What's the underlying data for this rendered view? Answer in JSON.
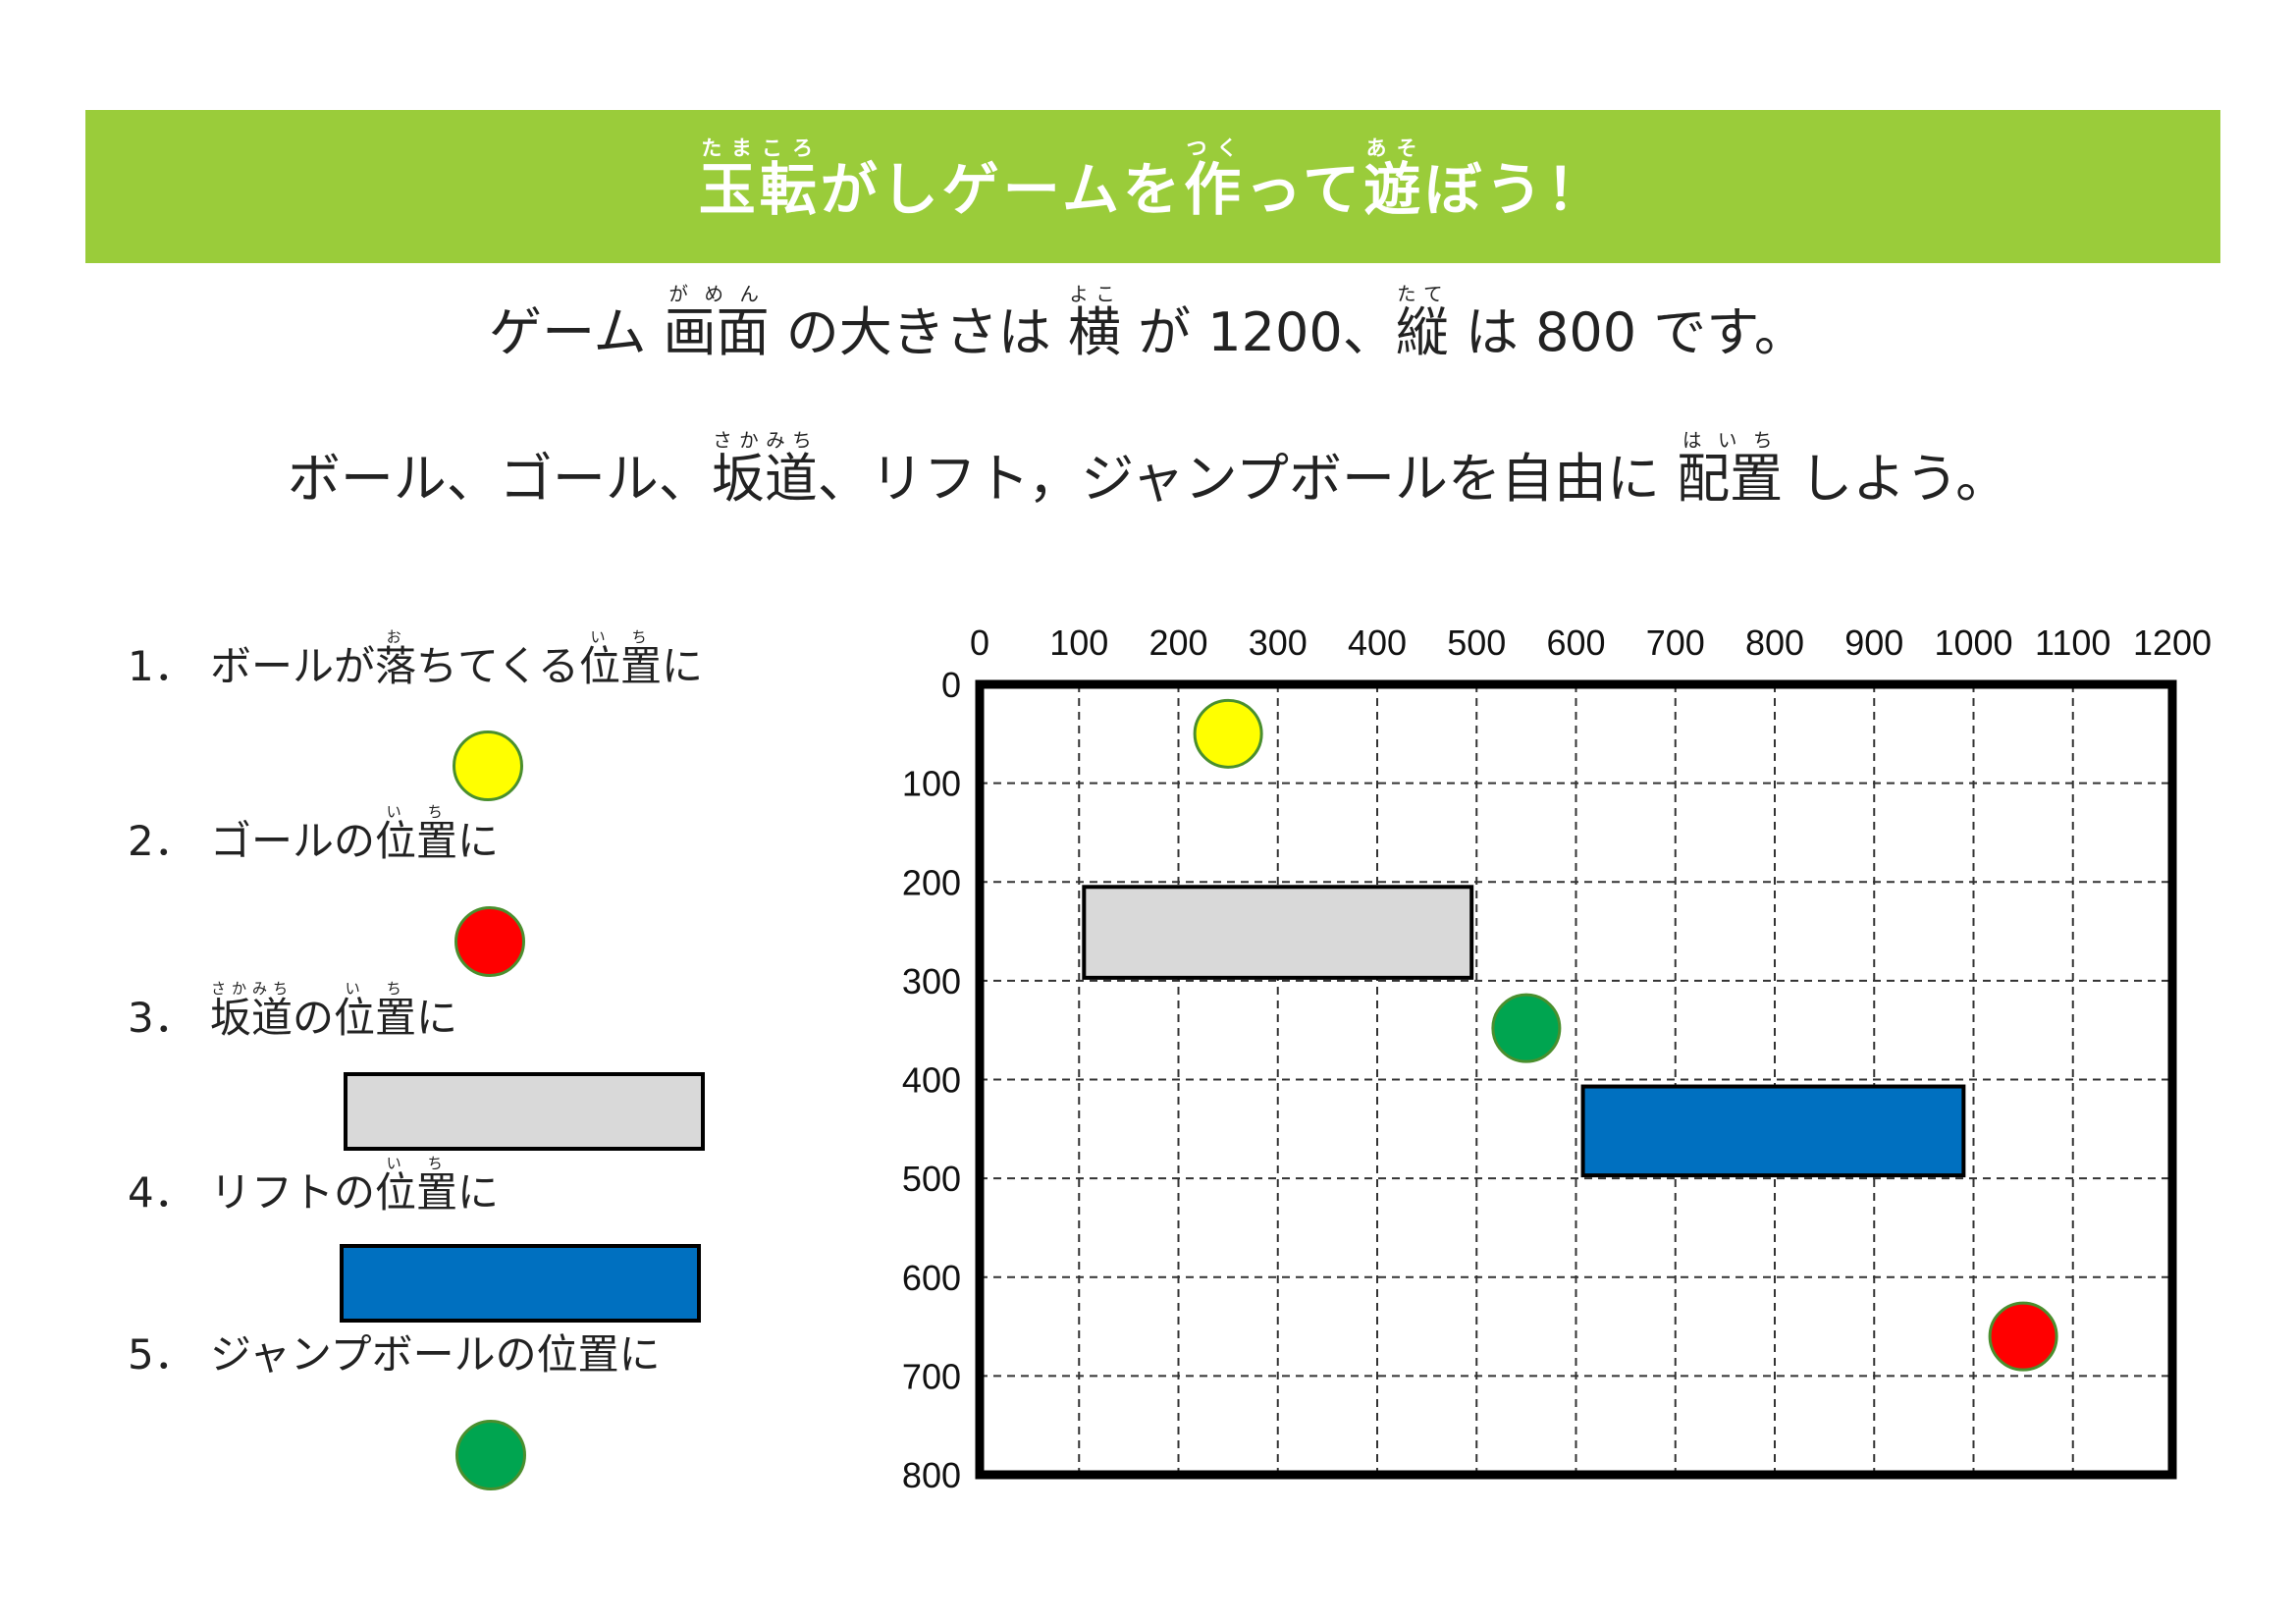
{
  "title": {
    "ruby_tamakoro": "たまころ",
    "kanji_tamakoro": "玉転",
    "part1": "がしゲームを",
    "ruby_tsuku": "つく",
    "kanji_tsuku": "作",
    "part2": "って",
    "ruby_aso": "あそ",
    "kanji_aso": "遊",
    "part3": "ぼう！"
  },
  "intro1": {
    "a": "ゲーム ",
    "ruby_gamen": "がめん",
    "kanji_gamen": "画面",
    "b": " の大きさは ",
    "ruby_yoko": "よこ",
    "kanji_yoko": "横",
    "c": " が 1200、",
    "ruby_tate": "たて",
    "kanji_tate": "縦",
    "d": " は 800 です。"
  },
  "intro2": {
    "a": "ボール、ゴール、",
    "ruby_sakamichi": "さかみち",
    "kanji_sakamichi": "坂道",
    "b": "、リフト，ジャンプボールを自由に ",
    "ruby_haichi": "はいち",
    "kanji_haichi": "配置",
    "c": " しよう。"
  },
  "steps": [
    {
      "num": "1．",
      "a": "ボールが",
      "ruby_o": "お",
      "kanji_o": "落",
      "b": "ちてくる",
      "ruby_ichi": "いち",
      "kanji_ichi": "位置",
      "c": "に",
      "icon": "yellow-ball"
    },
    {
      "num": "2．",
      "a": "ゴールの",
      "ruby_ichi": "いち",
      "kanji_ichi": "位置",
      "c": "に",
      "icon": "red-goal"
    },
    {
      "num": "3．",
      "ruby_sakamichi": "さかみち",
      "kanji_sakamichi": "坂道",
      "a": "の",
      "ruby_ichi": "いち",
      "kanji_ichi": "位置",
      "c": "に",
      "icon": "gray-slope"
    },
    {
      "num": "4．",
      "a": "リフトの",
      "ruby_ichi": "いち",
      "kanji_ichi": "位置",
      "c": "に",
      "icon": "blue-lift"
    },
    {
      "num": "5．",
      "a": "ジャンプボールの位置に",
      "icon": "green-jump-ball"
    }
  ],
  "colors": {
    "banner": "#9acc3a",
    "ball": "#ffff00",
    "goal": "#ff0000",
    "jump_ball": "#00a550",
    "slope": "#d9d9d9",
    "lift": "#0070c0"
  },
  "game_grid": {
    "x_range": [
      0,
      1200
    ],
    "y_range": [
      0,
      800
    ],
    "x_ticks": [
      "0",
      "100",
      "200",
      "300",
      "400",
      "500",
      "600",
      "700",
      "800",
      "900",
      "1000",
      "1100",
      "1200"
    ],
    "y_ticks": [
      "0",
      "100",
      "200",
      "300",
      "400",
      "500",
      "600",
      "700",
      "800"
    ],
    "objects": [
      {
        "kind": "ball",
        "color": "#ffff00",
        "x": 250,
        "y": 50
      },
      {
        "kind": "slope",
        "color": "#d9d9d9",
        "x1": 105,
        "y1": 205,
        "x2": 495,
        "y2": 297
      },
      {
        "kind": "jump-ball",
        "color": "#00a550",
        "x": 550,
        "y": 348
      },
      {
        "kind": "lift",
        "color": "#0070c0",
        "x1": 607,
        "y1": 407,
        "x2": 990,
        "y2": 497
      },
      {
        "kind": "goal",
        "color": "#ff0000",
        "x": 1050,
        "y": 660
      }
    ]
  }
}
